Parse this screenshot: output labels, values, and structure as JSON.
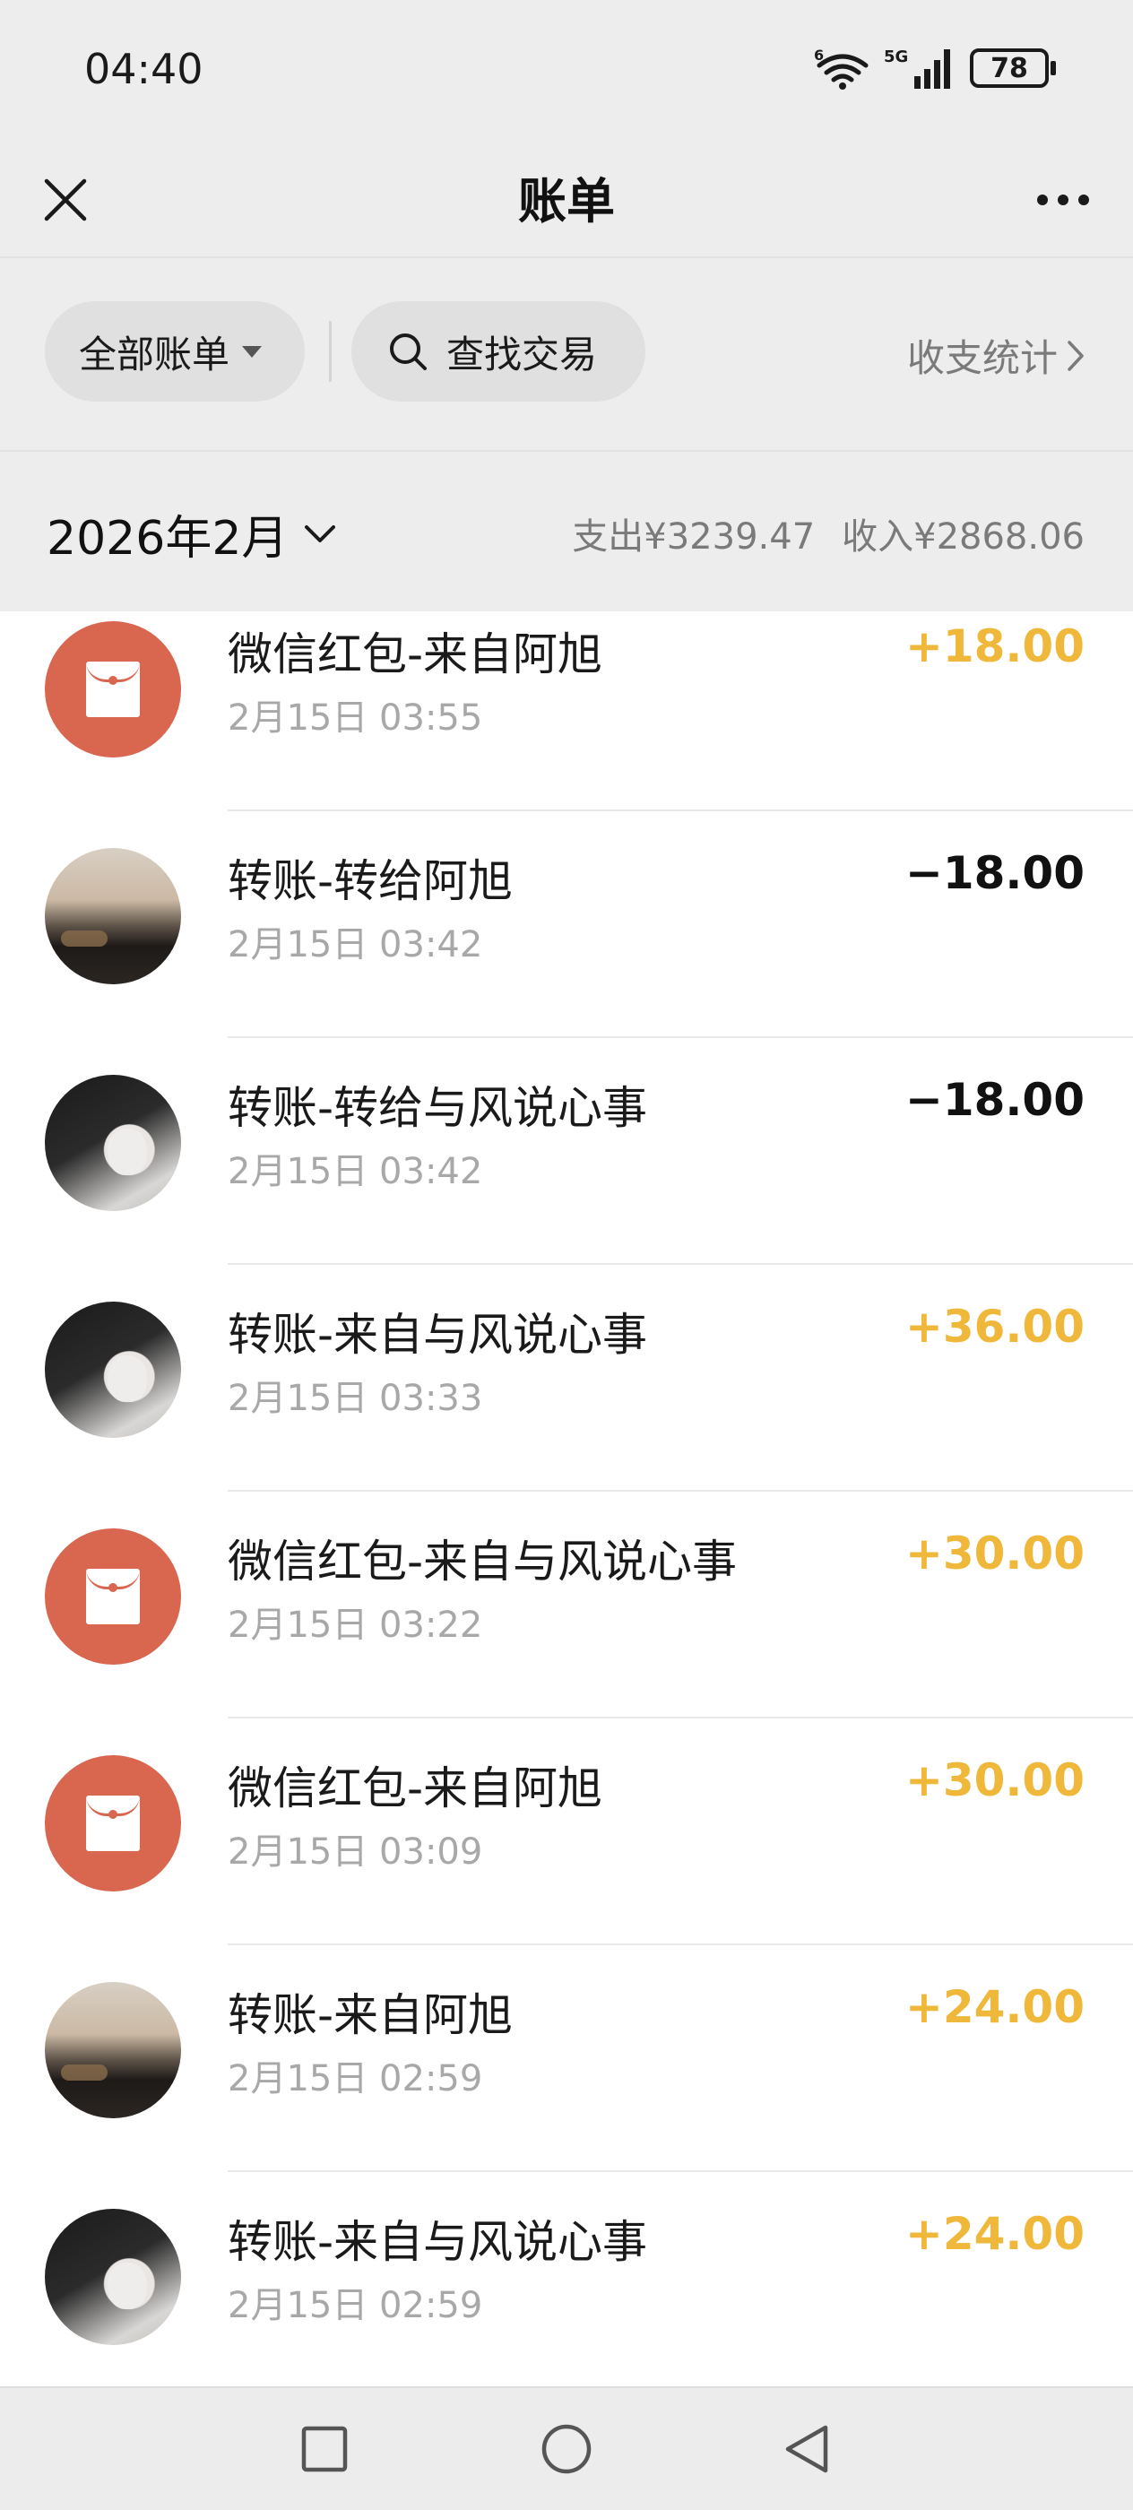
{
  "status_bar": {
    "time": "04:40",
    "wifi_label": "6",
    "network_label": "5G",
    "battery": "78"
  },
  "header": {
    "title": "账单",
    "close_icon": "close-icon",
    "more_icon": "more-icon"
  },
  "filters": {
    "all_bills": "全部账单",
    "search": "查找交易",
    "stats": "收支统计"
  },
  "month": {
    "label": "2026年2月",
    "expense": "支出¥3239.47",
    "income": "收入¥2868.06"
  },
  "transactions": [
    {
      "title": "微信红包-来自阿旭",
      "time": "2月15日 03:55",
      "amount": "+18.00",
      "type": "income",
      "avatar": "red-packet"
    },
    {
      "title": "转账-转给阿旭",
      "time": "2月15日 03:42",
      "amount": "−18.00",
      "type": "expense",
      "avatar": "car"
    },
    {
      "title": "转账-转给与风说心事",
      "time": "2月15日 03:42",
      "amount": "−18.00",
      "type": "expense",
      "avatar": "girl"
    },
    {
      "title": "转账-来自与风说心事",
      "time": "2月15日 03:33",
      "amount": "+36.00",
      "type": "income",
      "avatar": "girl"
    },
    {
      "title": "微信红包-来自与风说心事",
      "time": "2月15日 03:22",
      "amount": "+30.00",
      "type": "income",
      "avatar": "red-packet"
    },
    {
      "title": "微信红包-来自阿旭",
      "time": "2月15日 03:09",
      "amount": "+30.00",
      "type": "income",
      "avatar": "red-packet"
    },
    {
      "title": "转账-来自阿旭",
      "time": "2月15日 02:59",
      "amount": "+24.00",
      "type": "income",
      "avatar": "car"
    },
    {
      "title": "转账-来自与风说心事",
      "time": "2月15日 02:59",
      "amount": "+24.00",
      "type": "income",
      "avatar": "girl"
    }
  ],
  "colors": {
    "income": "#f0b83a",
    "expense": "#111111",
    "red_packet": "#d9664f",
    "header_bg": "#ededed"
  },
  "nav": {
    "recents_icon": "square-icon",
    "home_icon": "circle-icon",
    "back_icon": "triangle-back-icon"
  }
}
